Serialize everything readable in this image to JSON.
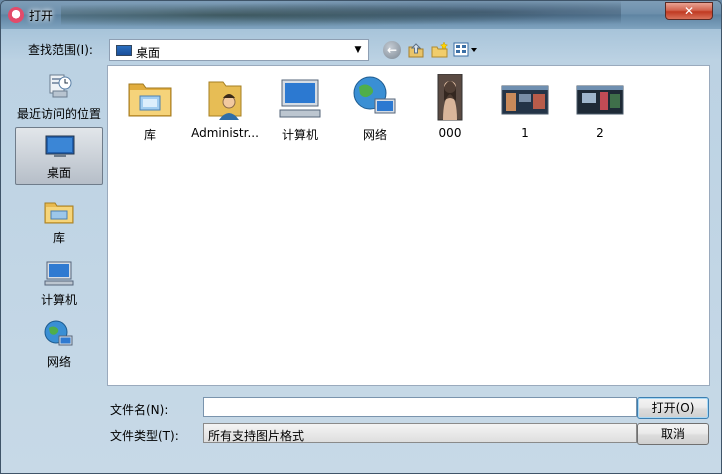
{
  "window": {
    "title": "打开",
    "close_label": "✕"
  },
  "toolbar": {
    "lookin_label": "查找范围(I):",
    "lookin_value": "桌面",
    "icons": [
      "back-icon",
      "up-folder-icon",
      "new-folder-icon",
      "view-menu-icon"
    ]
  },
  "places": [
    {
      "label": "最近访问的位置",
      "icon": "recent-places-icon"
    },
    {
      "label": "桌面",
      "icon": "desktop-icon",
      "selected": true
    },
    {
      "label": "库",
      "icon": "libraries-icon"
    },
    {
      "label": "计算机",
      "icon": "computer-icon"
    },
    {
      "label": "网络",
      "icon": "network-icon"
    }
  ],
  "files": [
    {
      "label": "库",
      "icon": "libraries-icon"
    },
    {
      "label": "Administr...",
      "icon": "user-folder-icon"
    },
    {
      "label": "计算机",
      "icon": "computer-icon"
    },
    {
      "label": "网络",
      "icon": "network-icon"
    },
    {
      "label": "000",
      "icon": "photo-thumbnail"
    },
    {
      "label": "1",
      "icon": "screenshot-thumbnail"
    },
    {
      "label": "2",
      "icon": "screenshot-thumbnail"
    }
  ],
  "footer": {
    "filename_label": "文件名(N):",
    "filename_value": "",
    "filetype_label": "文件类型(T):",
    "filetype_value": "所有支持图片格式",
    "open_label": "打开(O)",
    "cancel_label": "取消"
  }
}
